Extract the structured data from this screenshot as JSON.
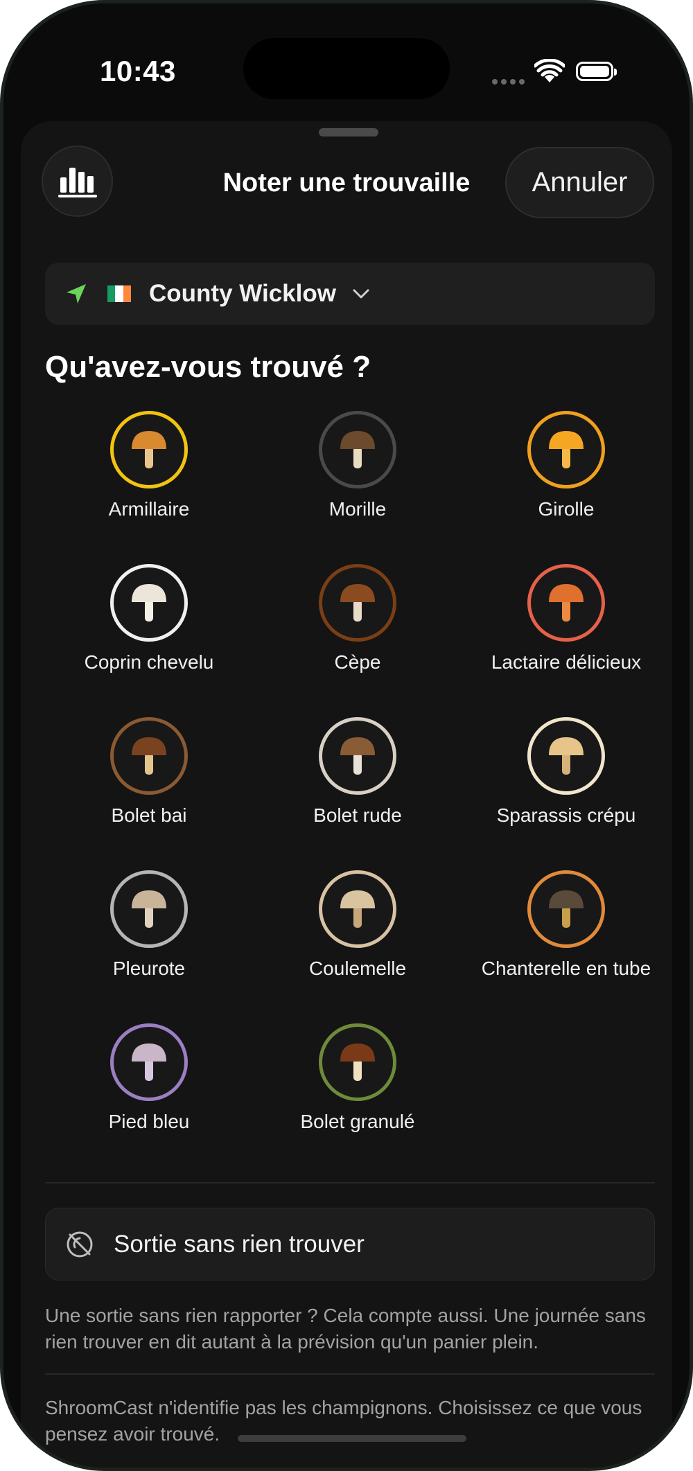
{
  "status_bar": {
    "time": "10:43"
  },
  "sheet": {
    "title": "Noter une trouvaille",
    "cancel_label": "Annuler",
    "stats_icon": "bar-chart-icon"
  },
  "location": {
    "icon": "location-arrow-icon",
    "flag": "ireland-flag",
    "name": "County Wicklow",
    "chevron": "chevron-down-icon"
  },
  "question": "Qu'avez-vous trouvé ?",
  "species": [
    {
      "label": "Armillaire",
      "ring": "#f1c40f",
      "cap": "#d9892e",
      "stem": "#e9c58d",
      "icon": "armillaire-mushroom-icon"
    },
    {
      "label": "Morille",
      "ring": "#4a4a4a",
      "cap": "#6b4a2e",
      "stem": "#e8dcc0",
      "icon": "morel-mushroom-icon"
    },
    {
      "label": "Girolle",
      "ring": "#f0a020",
      "cap": "#f5a623",
      "stem": "#f7b84a",
      "icon": "chanterelle-mushroom-icon"
    },
    {
      "label": "Coprin chevelu",
      "ring": "#f0f0f0",
      "cap": "#ece6da",
      "stem": "#f5f0e6",
      "icon": "shaggy-ink-cap-icon"
    },
    {
      "label": "Cèpe",
      "ring": "#7a3f14",
      "cap": "#8a4b20",
      "stem": "#e8dcc8",
      "icon": "porcini-mushroom-icon"
    },
    {
      "label": "Lactaire délicieux",
      "ring": "#e5614a",
      "cap": "#e0702e",
      "stem": "#ee8a40",
      "icon": "saffron-milk-cap-icon"
    },
    {
      "label": "Bolet bai",
      "ring": "#8a5a32",
      "cap": "#7a4320",
      "stem": "#e3c48c",
      "icon": "bay-bolete-icon"
    },
    {
      "label": "Bolet rude",
      "ring": "#d8d0c4",
      "cap": "#8a5c36",
      "stem": "#e8e2d6",
      "icon": "birch-bolete-icon"
    },
    {
      "label": "Sparassis crépu",
      "ring": "#f1e6cc",
      "cap": "#e6c48a",
      "stem": "#d6b27a",
      "icon": "cauliflower-fungus-icon"
    },
    {
      "label": "Pleurote",
      "ring": "#b5b5b5",
      "cap": "#c9b49a",
      "stem": "#e0d2bc",
      "icon": "oyster-mushroom-icon"
    },
    {
      "label": "Coulemelle",
      "ring": "#d8c2a2",
      "cap": "#d9c4a0",
      "stem": "#c8a67a",
      "icon": "parasol-mushroom-icon"
    },
    {
      "label": "Chanterelle en tube",
      "ring": "#e08a3a",
      "cap": "#5a4a3a",
      "stem": "#c9a04a",
      "icon": "winter-chanterelle-icon"
    },
    {
      "label": "Pied bleu",
      "ring": "#9b7fc2",
      "cap": "#c9b6c8",
      "stem": "#d8c6e0",
      "icon": "wood-blewit-icon"
    },
    {
      "label": "Bolet granulé",
      "ring": "#6f8a3a",
      "cap": "#7a3a18",
      "stem": "#f0e2c0",
      "icon": "weeping-bolete-icon"
    }
  ],
  "no_find": {
    "icon": "no-find-icon",
    "label": "Sortie sans rien trouver",
    "note": "Une sortie sans rien rapporter ? Cela compte aussi. Une journée sans rien trouver en dit autant à la prévision qu'un panier plein."
  },
  "disclaimer": "ShroomCast n'identifie pas les champignons. Choisissez ce que vous pensez avoir trouvé."
}
